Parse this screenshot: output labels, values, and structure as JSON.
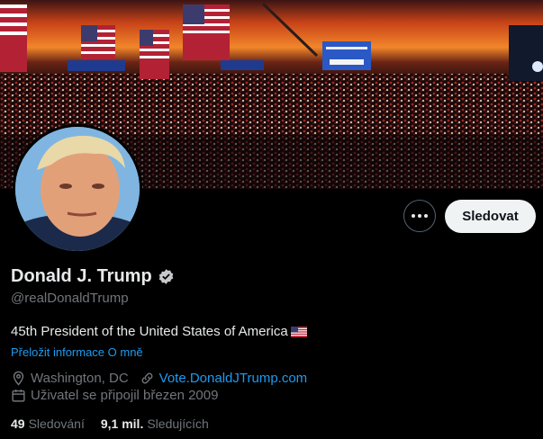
{
  "profile": {
    "name": "Donald J. Trump",
    "handle": "@realDonaldTrump",
    "bio": "45th President of the United States of America",
    "bio_flag_icon": "us-flag-icon",
    "translate_label": "Přeložit informace O mně",
    "location": "Washington, DC",
    "website": "Vote.DonaldJTrump.com",
    "joined": "Uživatel se připojil březen 2009",
    "following_count": "49",
    "following_label": "Sledování",
    "followers_count": "9,1 mil.",
    "followers_label": "Sledujících"
  },
  "actions": {
    "follow_label": "Sledovat",
    "more_icon": "more-horizontal-icon"
  },
  "colors": {
    "background": "#000000",
    "link": "#1d9bf0",
    "muted": "#71767b",
    "text": "#e7e9ea",
    "follow_button": "#eff3f4"
  }
}
